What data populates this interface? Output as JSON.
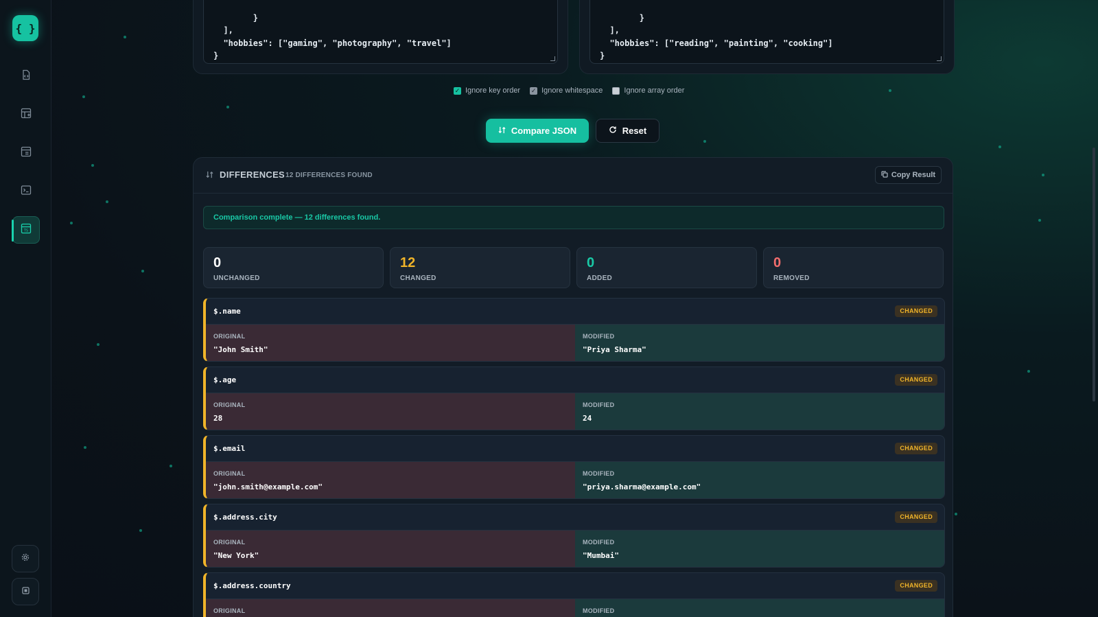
{
  "sidebar": {
    "logo": "{ }",
    "nav": [
      {
        "icon": "file-code-icon"
      },
      {
        "icon": "table-plus-icon"
      },
      {
        "icon": "layout-icon"
      },
      {
        "icon": "terminal-icon"
      },
      {
        "icon": "ts-file-icon",
        "active": true
      }
    ],
    "bottom": [
      {
        "icon": "settings-icon"
      },
      {
        "icon": "panel-icon"
      }
    ]
  },
  "editors": {
    "left": "    }\n  ],\n  \"hobbies\": [\"gaming\", \"photography\", \"travel\"]\n}",
    "right": "    }\n  ],\n  \"hobbies\": [\"reading\", \"painting\", \"cooking\"]\n}"
  },
  "options": [
    {
      "label": "Ignore key order",
      "checked": true
    },
    {
      "label": "Ignore whitespace",
      "checked": true
    },
    {
      "label": "Ignore array order",
      "checked": false
    }
  ],
  "actions": {
    "compare": "Compare JSON",
    "reset": "Reset"
  },
  "differences": {
    "title": "DIFFERENCES",
    "count_label": "12 DIFFERENCES FOUND",
    "copy_label": "Copy Result",
    "status": "Comparison complete — 12 differences found.",
    "stats": [
      {
        "value": "0",
        "label": "UNCHANGED",
        "color": "#ffffff"
      },
      {
        "value": "12",
        "label": "CHANGED",
        "color": "#f0b429"
      },
      {
        "value": "0",
        "label": "ADDED",
        "color": "#19c9a6"
      },
      {
        "value": "0",
        "label": "REMOVED",
        "color": "#f26d6d"
      }
    ],
    "items": [
      {
        "path": "$.name",
        "badge": "CHANGED",
        "original_label": "ORIGINAL",
        "modified_label": "MODIFIED",
        "original": "\"John Smith\"",
        "modified": "\"Priya Sharma\""
      },
      {
        "path": "$.age",
        "badge": "CHANGED",
        "original_label": "ORIGINAL",
        "modified_label": "MODIFIED",
        "original": "28",
        "modified": "24"
      },
      {
        "path": "$.email",
        "badge": "CHANGED",
        "original_label": "ORIGINAL",
        "modified_label": "MODIFIED",
        "original": "\"john.smith@example.com\"",
        "modified": "\"priya.sharma@example.com\""
      },
      {
        "path": "$.address.city",
        "badge": "CHANGED",
        "original_label": "ORIGINAL",
        "modified_label": "MODIFIED",
        "original": "\"New York\"",
        "modified": "\"Mumbai\""
      },
      {
        "path": "$.address.country",
        "badge": "CHANGED",
        "original_label": "ORIGINAL",
        "modified_label": "MODIFIED",
        "original": "",
        "modified": ""
      }
    ]
  },
  "colors": {
    "accent": "#16c2a1",
    "changed": "#f0b429",
    "removed": "#f26d6d"
  }
}
